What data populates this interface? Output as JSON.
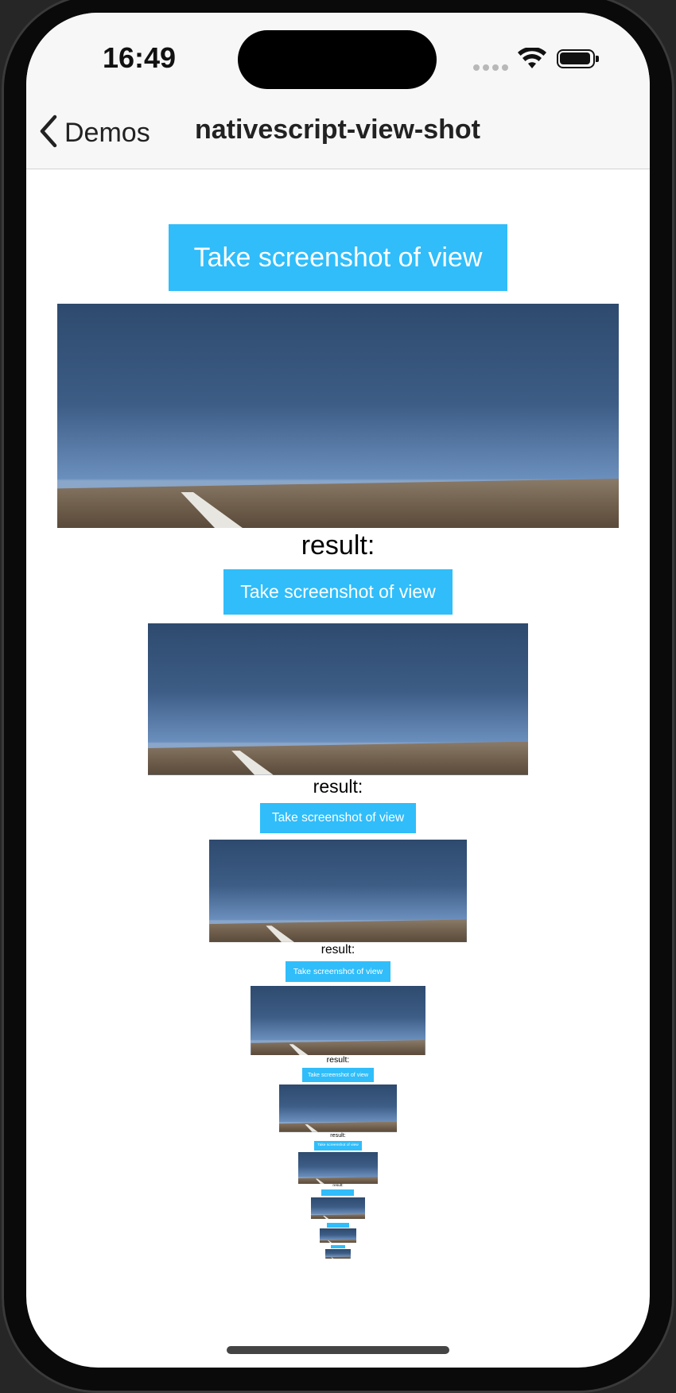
{
  "status_bar": {
    "time": "16:49"
  },
  "nav": {
    "back_label": "Demos",
    "title": "nativescript-view-shot"
  },
  "demo": {
    "button_label": "Take screenshot of view",
    "result_label": "result:"
  },
  "colors": {
    "accent": "#30bdfa",
    "nav_bg": "#f7f7f7"
  },
  "icons": [
    "chevron-left-icon",
    "wifi-icon",
    "battery-icon",
    "signal-icon"
  ]
}
